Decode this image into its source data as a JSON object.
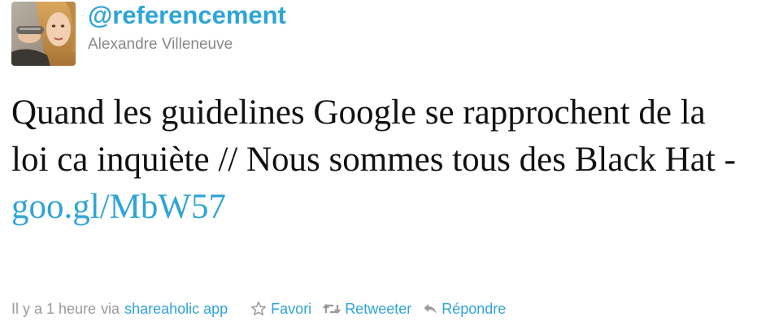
{
  "tweet": {
    "screen_name": "@referencement",
    "full_name": "Alexandre Villeneuve",
    "text": "Quand les guidelines Google se rapprochent de la loi ca inquiète // Nous sommes tous des Black Hat - ",
    "link": "goo.gl/MbW57",
    "timestamp": "Il y a 1 heure",
    "via_label": "via",
    "source": "shareaholic app",
    "actions": {
      "favorite": "Favori",
      "retweet": "Retweeter",
      "reply": "Répondre"
    },
    "avatar_icon": "user-avatar-photo",
    "colors": {
      "link": "#2fa4d7",
      "meta": "#999999",
      "full_name": "#888888",
      "text": "#111111"
    }
  }
}
